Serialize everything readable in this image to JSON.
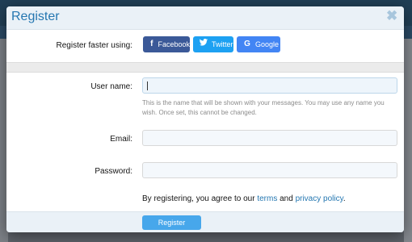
{
  "modal": {
    "title": "Register",
    "close_icon": "close-icon"
  },
  "social": {
    "label": "Register faster using:",
    "buttons": [
      {
        "label": "Facebook",
        "icon": "facebook-icon",
        "color": "#3b5998"
      },
      {
        "label": "Twitter",
        "icon": "twitter-icon",
        "color": "#1da1f2"
      },
      {
        "label": "Google",
        "icon": "google-icon",
        "color": "#4285f4"
      }
    ]
  },
  "form": {
    "username": {
      "label": "User name:",
      "value": "",
      "hint": "This is the name that will be shown with your messages. You may use any name you wish. Once set, this cannot be changed."
    },
    "email": {
      "label": "Email:",
      "value": ""
    },
    "password": {
      "label": "Password:",
      "value": ""
    },
    "agreement": {
      "prefix": "By registering, you agree to our",
      "terms": "terms",
      "and": "and",
      "privacy": "privacy policy",
      "suffix": "."
    }
  },
  "footer": {
    "register_label": "Register",
    "accent": "#47a7eb"
  }
}
